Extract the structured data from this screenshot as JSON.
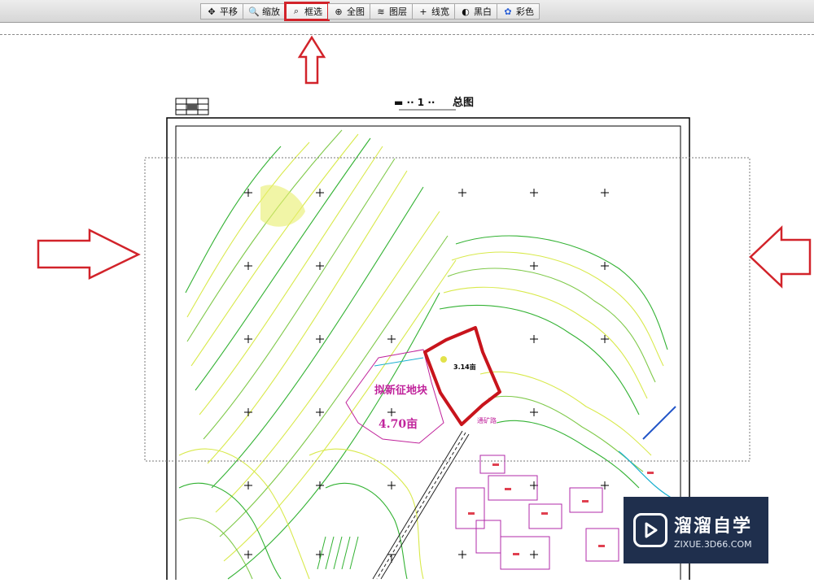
{
  "toolbar": {
    "buttons": [
      {
        "label": "平移",
        "icon": "pan-icon"
      },
      {
        "label": "缩放",
        "icon": "zoom-icon"
      },
      {
        "label": "框选",
        "icon": "box-select-icon"
      },
      {
        "label": "全图",
        "icon": "full-view-icon"
      },
      {
        "label": "图层",
        "icon": "layers-icon"
      },
      {
        "label": "线宽",
        "icon": "line-width-icon"
      },
      {
        "label": "黑白",
        "icon": "black-white-icon"
      },
      {
        "label": "彩色",
        "icon": "color-icon"
      }
    ],
    "active": "框选"
  },
  "drawing": {
    "title": "总图",
    "parcel_small_area": "3.14亩",
    "proposed_label": "拟新征地块",
    "proposed_area": "4.70亩",
    "road_label": "通矿路"
  },
  "watermark": {
    "brand": "溜溜自学",
    "url": "ZIXUE.3D66.COM"
  },
  "colors": {
    "annotation_red": "#d2232a",
    "contour_green": "#33b233",
    "contour_yellow": "#d8e94a",
    "label_magenta": "#c0239b"
  }
}
